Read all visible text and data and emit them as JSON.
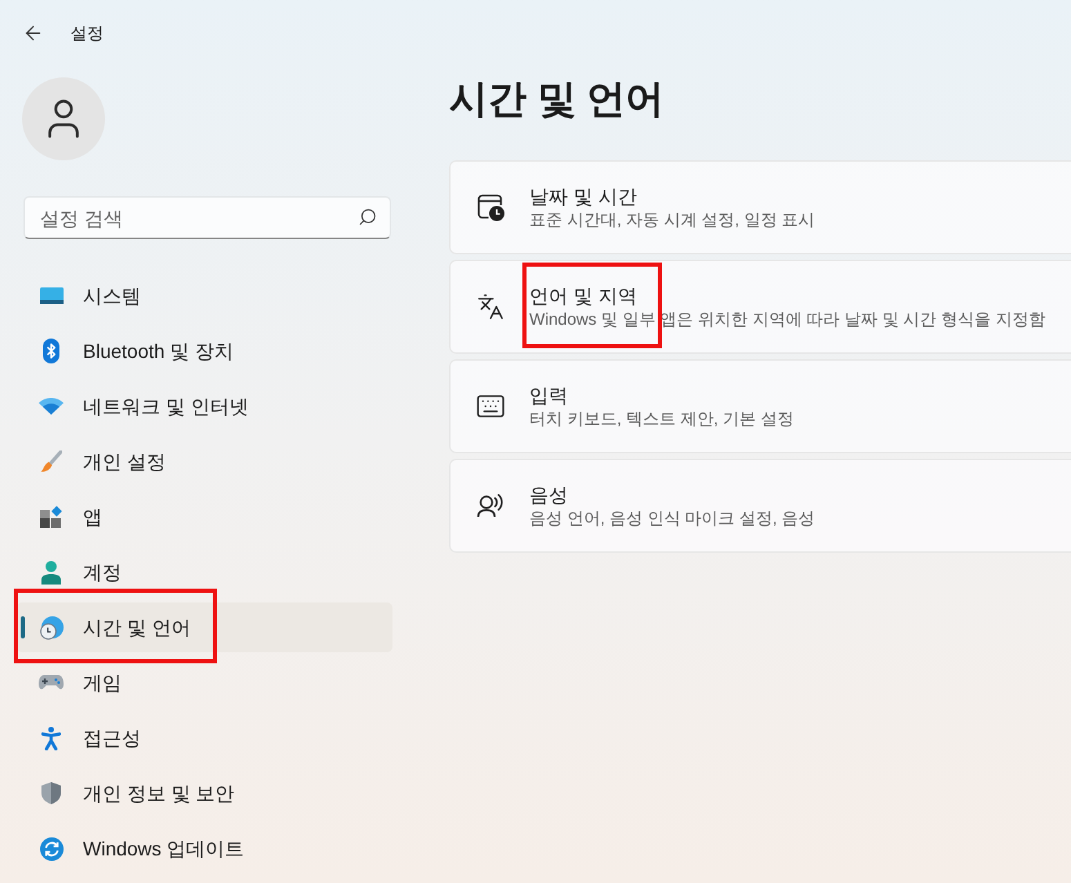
{
  "window": {
    "title": "설정"
  },
  "search": {
    "placeholder": "설정 검색"
  },
  "nav": [
    {
      "label": "시스템",
      "selected": false,
      "highlighted": false
    },
    {
      "label": "Bluetooth 및 장치",
      "selected": false,
      "highlighted": false
    },
    {
      "label": "네트워크 및 인터넷",
      "selected": false,
      "highlighted": false
    },
    {
      "label": "개인 설정",
      "selected": false,
      "highlighted": false
    },
    {
      "label": "앱",
      "selected": false,
      "highlighted": false
    },
    {
      "label": "계정",
      "selected": false,
      "highlighted": false
    },
    {
      "label": "시간 및 언어",
      "selected": true,
      "highlighted": true
    },
    {
      "label": "게임",
      "selected": false,
      "highlighted": false
    },
    {
      "label": "접근성",
      "selected": false,
      "highlighted": false
    },
    {
      "label": "개인 정보 및 보안",
      "selected": false,
      "highlighted": false
    },
    {
      "label": "Windows 업데이트",
      "selected": false,
      "highlighted": false
    }
  ],
  "page": {
    "title": "시간 및 언어"
  },
  "cards": [
    {
      "title": "날짜 및 시간",
      "description": "표준 시간대, 자동 시계 설정, 일정 표시",
      "highlighted": false
    },
    {
      "title": "언어 및 지역",
      "description": "Windows 및 일부 앱은 위치한 지역에 따라 날짜 및 시간 형식을 지정함",
      "highlighted": true
    },
    {
      "title": "입력",
      "description": "터치 키보드, 텍스트 제안, 기본 설정",
      "highlighted": false
    },
    {
      "title": "음성",
      "description": "음성 언어, 음성 인식 마이크 설정, 음성",
      "highlighted": false
    }
  ]
}
